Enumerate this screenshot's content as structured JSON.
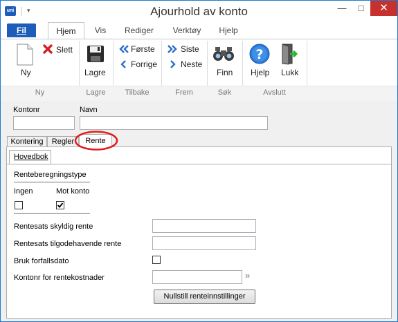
{
  "window": {
    "title": "Ajourhold av konto",
    "app_logo": "uni",
    "qa_arrow": "▾",
    "minimize": "—",
    "maximize": "□",
    "close": "✕"
  },
  "ribbon_tabs": [
    "Fil",
    "Hjem",
    "Vis",
    "Rediger",
    "Verktøy",
    "Hjelp"
  ],
  "ribbon": {
    "ny": "Ny",
    "slett": "Slett",
    "lagre": "Lagre",
    "forste": "Første",
    "forrige": "Forrige",
    "siste": "Siste",
    "neste": "Neste",
    "finn": "Finn",
    "hjelp": "Hjelp",
    "lukk": "Lukk",
    "groups": [
      "Ny",
      "Lagre",
      "Tilbake",
      "Frem",
      "Søk",
      "Avslutt"
    ]
  },
  "form": {
    "kontonr_label": "Kontonr",
    "navn_label": "Navn",
    "kontonr_value": "",
    "navn_value": "",
    "tabs": [
      "Kontering",
      "Regler",
      "Rente"
    ],
    "active_tab": "Rente",
    "subtab": "Hovedbok",
    "renteberegningstype": "Renteberegningstype",
    "ingen": "Ingen",
    "mot_konto": "Mot konto",
    "ingen_checked": false,
    "mot_konto_checked": true,
    "rentesats_skyldig": "Rentesats skyldig rente",
    "rentesats_tilgode": "Rentesats tilgodehavende rente",
    "bruk_forfallsdato": "Bruk forfallsdato",
    "kontonr_rentekostnader": "Kontonr for rentekostnader",
    "lookup_arrow": "»",
    "nullstill_button": "Nullstill renteinnstillinger"
  },
  "colors": {
    "accent": "#1d5cb8",
    "highlight": "#e11b1b",
    "close_button": "#c7312d"
  }
}
